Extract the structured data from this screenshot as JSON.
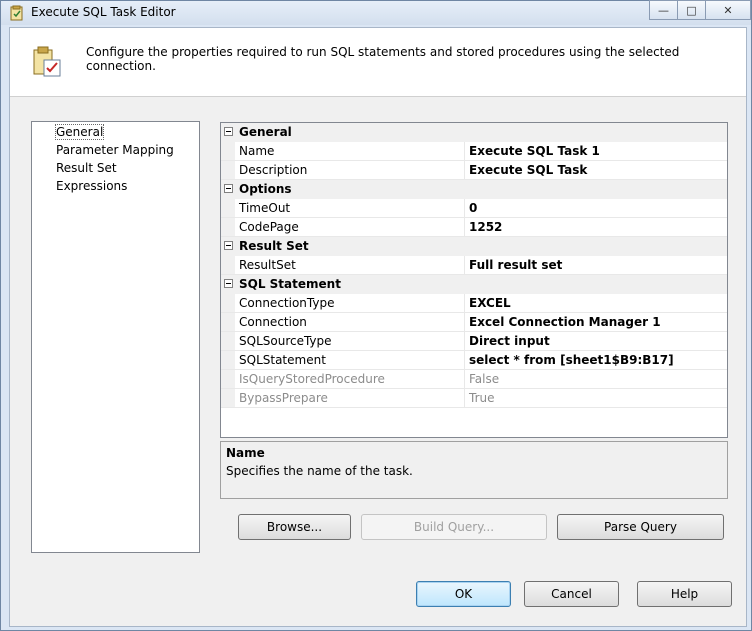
{
  "window": {
    "title": "Execute SQL Task Editor",
    "minimize": "—",
    "maximize": "□",
    "close": "✕"
  },
  "header": {
    "text": "Configure the properties required to run SQL statements and stored procedures using the selected connection."
  },
  "nav": {
    "items": [
      "General",
      "Parameter Mapping",
      "Result Set",
      "Expressions"
    ],
    "selected": "General"
  },
  "grid": {
    "general_label": "General",
    "name_label": "Name",
    "name_value": "Execute SQL Task 1",
    "description_label": "Description",
    "description_value": "Execute SQL Task",
    "options_label": "Options",
    "timeout_label": "TimeOut",
    "timeout_value": "0",
    "codepage_label": "CodePage",
    "codepage_value": "1252",
    "resultset_cat_label": "Result Set",
    "resultset_label": "ResultSet",
    "resultset_value": "Full result set",
    "sql_cat_label": "SQL Statement",
    "conntype_label": "ConnectionType",
    "conntype_value": "EXCEL",
    "connection_label": "Connection",
    "connection_value": "Excel Connection Manager 1",
    "sqlsource_label": "SQLSourceType",
    "sqlsource_value": "Direct input",
    "sqlstatement_label": "SQLStatement",
    "sqlstatement_value": "select * from [sheet1$B9:B17]",
    "isquery_label": "IsQueryStoredProcedure",
    "isquery_value": "False",
    "bypass_label": "BypassPrepare",
    "bypass_value": "True"
  },
  "description": {
    "title": "Name",
    "text": "Specifies the name of the task."
  },
  "buttons": {
    "browse": "Browse...",
    "build_query": "Build Query...",
    "parse_query": "Parse Query",
    "ok": "OK",
    "cancel": "Cancel",
    "help": "Help"
  }
}
